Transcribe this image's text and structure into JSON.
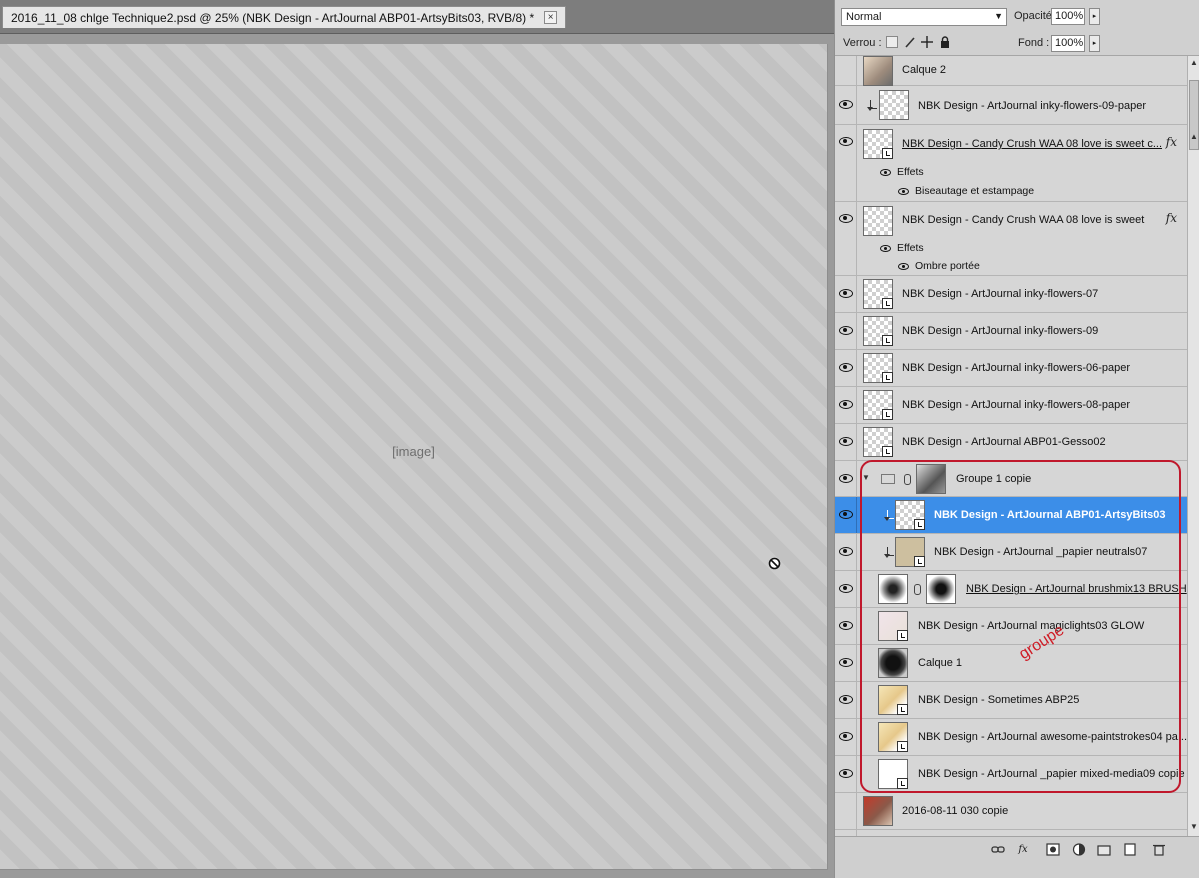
{
  "window": {
    "doc_tab_title": "2016_11_08 chlge Technique2.psd @ 25% (NBK Design - ArtJournal ABP01-ArtsyBits03, RVB/8) *",
    "close_glyph": "×"
  },
  "canvas": {
    "placeholder_caption": "[image]"
  },
  "panel": {
    "blend_mode": "Normal",
    "opacity_label": "Opacité :",
    "opacity_value": "100%",
    "lock_label": "Verrou :",
    "fill_label": "Fond :",
    "fill_value": "100%"
  },
  "layers": [
    {
      "name": "Calque 2",
      "visible": false,
      "thumb": "photo"
    },
    {
      "name": "NBK Design - ArtJournal inky-flowers-09-paper",
      "visible": true,
      "clipped": true
    },
    {
      "name": "NBK Design - Candy Crush WAA 08 love is sweet c...",
      "visible": true,
      "fx": true,
      "underline": true
    },
    {
      "name": "NBK Design - Candy Crush WAA 08 love is sweet",
      "visible": true,
      "fx": true
    },
    {
      "name": "NBK Design - ArtJournal inky-flowers-07",
      "visible": true
    },
    {
      "name": "NBK Design - ArtJournal inky-flowers-09",
      "visible": true
    },
    {
      "name": "NBK Design - ArtJournal inky-flowers-06-paper",
      "visible": true
    },
    {
      "name": "NBK Design - ArtJournal inky-flowers-08-paper",
      "visible": true
    },
    {
      "name": "NBK Design - ArtJournal ABP01-Gesso02",
      "visible": true
    },
    {
      "name": "Groupe 1 copie",
      "visible": true,
      "group": true
    },
    {
      "name": "NBK Design - ArtJournal ABP01-ArtsyBits03",
      "visible": true,
      "selected": true,
      "clipped": true
    },
    {
      "name": "NBK Design - ArtJournal _papier neutrals07",
      "visible": true,
      "clipped": true
    },
    {
      "name": "NBK Design - ArtJournal brushmix13 BRUSH",
      "visible": true,
      "underline": true,
      "mask": true
    },
    {
      "name": "NBK Design - ArtJournal magiclights03 GLOW",
      "visible": true
    },
    {
      "name": "Calque 1",
      "visible": true
    },
    {
      "name": "NBK Design - Sometimes ABP25",
      "visible": true
    },
    {
      "name": "NBK Design - ArtJournal awesome-paintstrokes04 pa...",
      "visible": true
    },
    {
      "name": "NBK Design - ArtJournal _papier mixed-media09 copie",
      "visible": true
    },
    {
      "name": "2016-08-11 030 copie",
      "visible": false
    }
  ],
  "effects": [
    {
      "header": "Effets",
      "item": "Biseautage et estampage"
    },
    {
      "header": "Effets",
      "item": "Ombre portée"
    }
  ],
  "annotation": {
    "text": "groupe",
    "color": "#cf1c26"
  },
  "icons": {
    "fx": "fx",
    "up_arrow": "▲",
    "down_arrow": "▼",
    "dropdown": "▼",
    "spin": "▸"
  },
  "colors": {
    "selection": "#3c8ee8",
    "outline": "#c0182c"
  }
}
